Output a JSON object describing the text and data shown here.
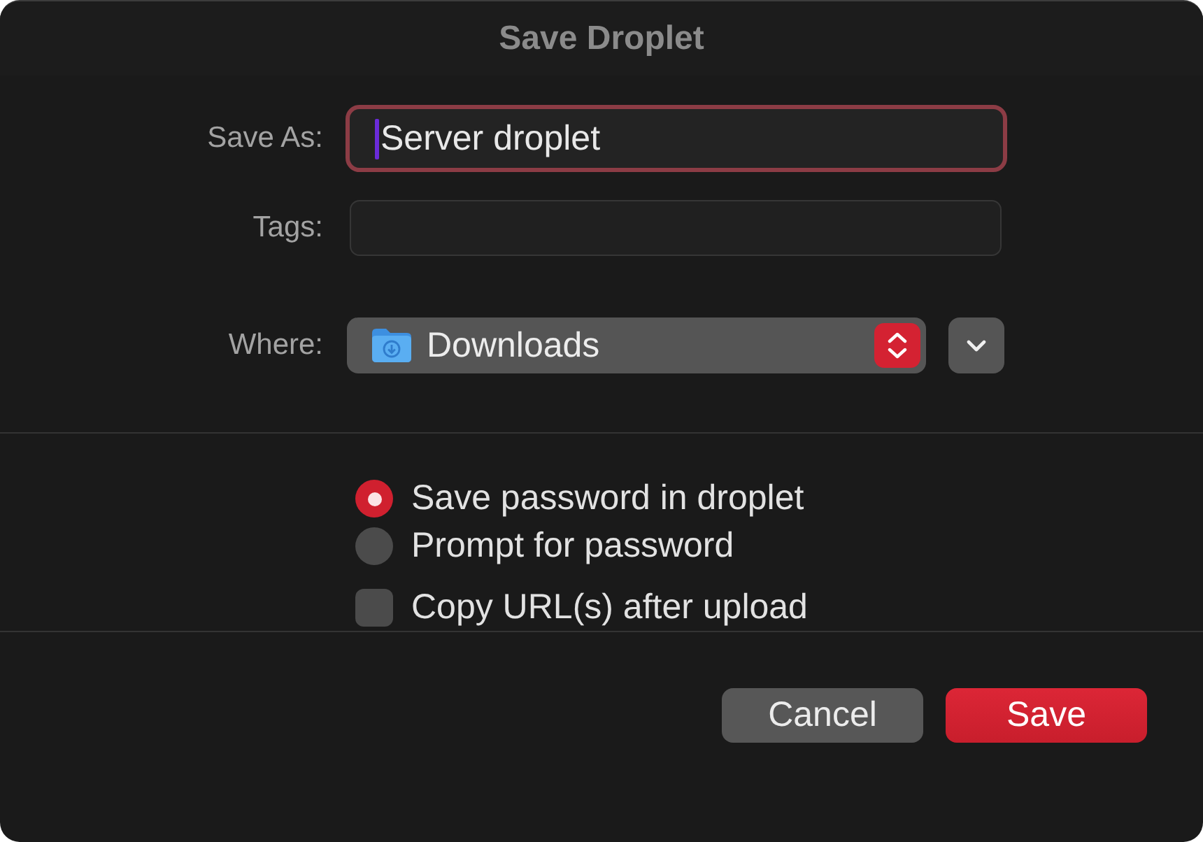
{
  "window": {
    "title": "Save Droplet"
  },
  "form": {
    "save_as": {
      "label": "Save As:",
      "value": "Server droplet",
      "focused": true
    },
    "tags": {
      "label": "Tags:"
    },
    "where": {
      "label": "Where:",
      "value": "Downloads",
      "expanded": false
    }
  },
  "password_options": [
    {
      "label": "Save password in droplet",
      "selected": true
    },
    {
      "label": "Prompt for password",
      "selected": false
    }
  ],
  "copy_urls": {
    "label": "Copy URL(s) after upload",
    "checked": false
  },
  "buttons": [
    {
      "label": "Cancel",
      "kind": "secondary"
    },
    {
      "label": "Save",
      "kind": "primary"
    }
  ]
}
